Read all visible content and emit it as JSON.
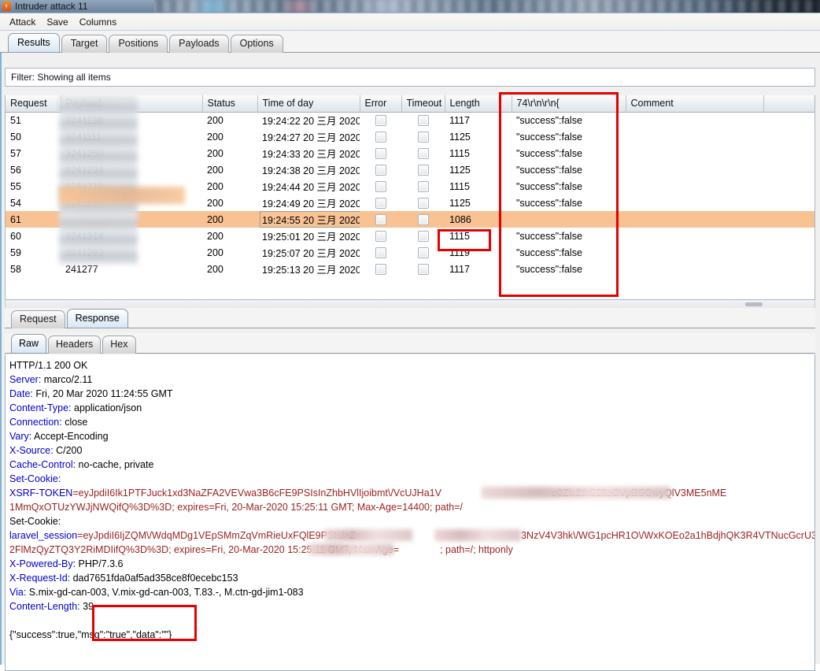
{
  "window": {
    "title": "Intruder attack 11",
    "app_icon": "burp-intruder-icon"
  },
  "menubar": {
    "items": [
      {
        "label": "Attack"
      },
      {
        "label": "Save"
      },
      {
        "label": "Columns"
      }
    ]
  },
  "main_tabs": {
    "active": "Results",
    "items": [
      {
        "label": "Results"
      },
      {
        "label": "Target"
      },
      {
        "label": "Positions"
      },
      {
        "label": "Payloads"
      },
      {
        "label": "Options"
      }
    ]
  },
  "filter": {
    "label": "Filter: Showing all items"
  },
  "results_table": {
    "columns": [
      {
        "key": "request",
        "label": "Request"
      },
      {
        "key": "payload",
        "label": "Payload"
      },
      {
        "key": "status",
        "label": "Status"
      },
      {
        "key": "time_of_day",
        "label": "Time of day"
      },
      {
        "key": "error",
        "label": "Error"
      },
      {
        "key": "timeout",
        "label": "Timeout"
      },
      {
        "key": "length",
        "label": "Length"
      },
      {
        "key": "grep",
        "label": "74\\r\\n\\r\\n{"
      },
      {
        "key": "comment",
        "label": "Comment"
      }
    ],
    "rows": [
      {
        "request": "51",
        "payload_suffix": "3241138",
        "status": "200",
        "time_of_day": "19:24:22 20 三月 2020",
        "error": false,
        "timeout": false,
        "length": "1117",
        "grep": "\"success\":false",
        "comment": "",
        "selected": false
      },
      {
        "request": "50",
        "payload_suffix": "3241111",
        "status": "200",
        "time_of_day": "19:24:27 20 三月 2020",
        "error": false,
        "timeout": false,
        "length": "1125",
        "grep": "\"success\":false",
        "comment": "",
        "selected": false
      },
      {
        "request": "57",
        "payload_suffix": "3241250",
        "status": "200",
        "time_of_day": "19:24:33 20 三月 2020",
        "error": false,
        "timeout": false,
        "length": "1115",
        "grep": "\"success\":false",
        "comment": "",
        "selected": false
      },
      {
        "request": "56",
        "payload_suffix": "8241234",
        "status": "200",
        "time_of_day": "19:24:38 20 三月 2020",
        "error": false,
        "timeout": false,
        "length": "1125",
        "grep": "\"success\":false",
        "comment": "",
        "selected": false
      },
      {
        "request": "55",
        "payload_suffix": "8241218",
        "status": "200",
        "time_of_day": "19:24:44 20 三月 2020",
        "error": false,
        "timeout": false,
        "length": "1115",
        "grep": "\"success\":false",
        "comment": "",
        "selected": false
      },
      {
        "request": "54",
        "payload_suffix": "8241197",
        "status": "200",
        "time_of_day": "19:24:49 20 三月 2020",
        "error": false,
        "timeout": false,
        "length": "1125",
        "grep": "\"success\":false",
        "comment": "",
        "selected": false
      },
      {
        "request": "61",
        "payload_suffix": "",
        "status": "200",
        "time_of_day": "19:24:55 20 三月 2020",
        "error": false,
        "timeout": false,
        "length": "1086",
        "grep": "",
        "comment": "",
        "selected": true
      },
      {
        "request": "60",
        "payload_suffix": "8241314",
        "status": "200",
        "time_of_day": "19:25:01 20 三月 2020",
        "error": false,
        "timeout": false,
        "length": "1115",
        "grep": "\"success\":false",
        "comment": "",
        "selected": false
      },
      {
        "request": "59",
        "payload_suffix": "3241293",
        "status": "200",
        "time_of_day": "19:25:07 20 三月 2020",
        "error": false,
        "timeout": false,
        "length": "1119",
        "grep": "\"success\":false",
        "comment": "",
        "selected": false
      },
      {
        "request": "58",
        "payload_suffix": "241277",
        "status": "200",
        "time_of_day": "19:25:13 20 三月 2020",
        "error": false,
        "timeout": false,
        "length": "1117",
        "grep": "\"success\":false",
        "comment": "",
        "selected": false
      }
    ]
  },
  "message_tabs": {
    "active": "Response",
    "items": [
      {
        "label": "Request"
      },
      {
        "label": "Response"
      }
    ]
  },
  "view_tabs": {
    "active": "Raw",
    "items": [
      {
        "label": "Raw"
      },
      {
        "label": "Headers"
      },
      {
        "label": "Hex"
      }
    ]
  },
  "response": {
    "status_line": "HTTP/1.1 200 OK",
    "headers": [
      {
        "name": "Server:",
        "value": " marco/2.11"
      },
      {
        "name": "Date:",
        "value": " Fri, 20 Mar 2020 11:24:55 GMT"
      },
      {
        "name": "Content-Type:",
        "value": " application/json"
      },
      {
        "name": "Connection:",
        "value": " close"
      },
      {
        "name": "Vary:",
        "value": " Accept-Encoding"
      },
      {
        "name": "X-Source:",
        "value": " C/200"
      },
      {
        "name": "Cache-Control:",
        "value": " no-cache, private"
      },
      {
        "name": "Set-Cookie:",
        "value": ""
      }
    ],
    "cookie1": {
      "name": "XSRF-TOKEN",
      "line1_visible": "=eyJpdiI6Ik1PTFJuck1xd3NaZFA2VEVwa3B6cFE9PSIsInZhbHVlIjoibmt\\/VcUJHa1V",
      "line1_tail": "o0Zlc2thS28zOVpBSGwyQlV3ME5nME",
      "line2": "1MmQxOTUzYWJjNWQifQ%3D%3D; expires=Fri, 20-Mar-2020 15:25:11 GMT; Max-Age=14400; path=/"
    },
    "set_cookie_label": "Set-Cookie:",
    "cookie2": {
      "name": "laravel_session",
      "line1_visible": "=eyJpdiI6IjZQM\\/WdqMDg1VEpSMmZqVmRieUxFQlE9PSIsInZ",
      "line1_tail": "3NzV4V3hk\\/WG1pcHR1O\\/WxKOEo2a1hBdjhQK3R4VTNucGcrU3",
      "line2": "2FlMzQyZTQ3Y2RiMDIifQ%3D%3D; expires=Fri, 20-Mar-2020 15:25:11 GMT; Max-Age=",
      "line2_tail": "; path=/; httponly"
    },
    "trailing_headers": [
      {
        "name": "X-Powered-By:",
        "value": " PHP/7.3.6"
      },
      {
        "name": "X-Request-Id:",
        "value": " dad7651fda0af5ad358ce8f0ecebc153"
      },
      {
        "name": "Via:",
        "value": " S.mix-gd-can-003, V.mix-gd-can-003, T.83.-, M.ctn-gd-jim1-083"
      },
      {
        "name": "Content-Length:",
        "value": " 39"
      }
    ],
    "body": "{\"success\":true,\"msg\":\"true\",\"data\":\"\"}"
  },
  "annotations": {
    "color": "#e60000",
    "boxes": [
      {
        "name": "grep-column-highlight"
      },
      {
        "name": "length-1086-highlight"
      },
      {
        "name": "response-body-highlight"
      }
    ]
  }
}
